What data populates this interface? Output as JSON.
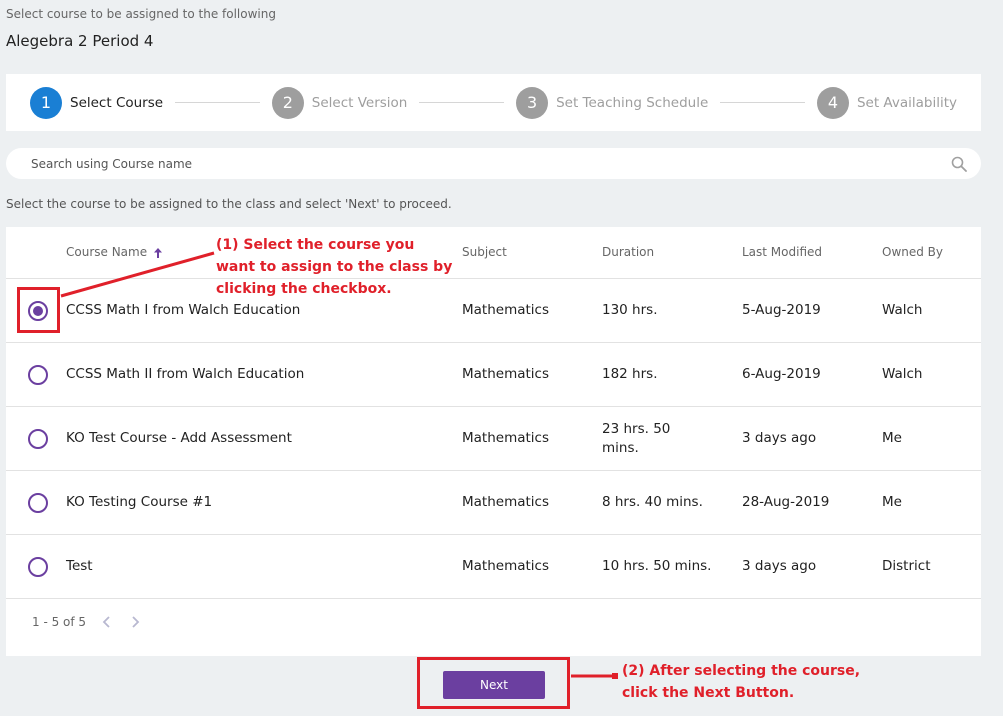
{
  "header": {
    "hint": "Select course to be assigned to the following",
    "class_name": "Alegebra 2 Period 4"
  },
  "stepper": {
    "steps": [
      {
        "number": "1",
        "label": "Select Course"
      },
      {
        "number": "2",
        "label": "Select Version"
      },
      {
        "number": "3",
        "label": "Set Teaching Schedule"
      },
      {
        "number": "4",
        "label": "Set Availability"
      }
    ]
  },
  "search": {
    "placeholder": "Search using Course name",
    "icon": "search-icon"
  },
  "instruction": "Select the course to be assigned to the class and select 'Next' to proceed.",
  "table": {
    "columns": {
      "name": "Course Name",
      "subject": "Subject",
      "duration": "Duration",
      "modified": "Last Modified",
      "owner": "Owned By"
    },
    "rows": [
      {
        "name": "CCSS Math I from Walch Education",
        "subject": "Mathematics",
        "duration": "130 hrs.",
        "modified": "5-Aug-2019",
        "owner": "Walch",
        "selected": true
      },
      {
        "name": "CCSS Math II from Walch Education",
        "subject": "Mathematics",
        "duration": "182 hrs.",
        "modified": "6-Aug-2019",
        "owner": "Walch",
        "selected": false
      },
      {
        "name": "KO Test Course - Add Assessment",
        "subject": "Mathematics",
        "duration": "23 hrs. 50 mins.",
        "modified": "3 days ago",
        "owner": "Me",
        "selected": false
      },
      {
        "name": "KO Testing Course #1",
        "subject": "Mathematics",
        "duration": "8 hrs. 40 mins.",
        "modified": "28-Aug-2019",
        "owner": "Me",
        "selected": false
      },
      {
        "name": "Test",
        "subject": "Mathematics",
        "duration": "10 hrs. 50 mins.",
        "modified": "3 days ago",
        "owner": "District",
        "selected": false
      }
    ]
  },
  "pagination": {
    "range": "1 - 5 of 5"
  },
  "next_button": "Next",
  "annotations": {
    "callout_1": [
      "(1) Select the course you",
      "want to assign to the class by",
      "clicking the checkbox."
    ],
    "callout_2": [
      "(2) After selecting the course,",
      "click the Next Button."
    ]
  },
  "colors": {
    "accent": "#6b3fa0",
    "active_step": "#1a7fd4",
    "annotation": "#e0202a"
  }
}
